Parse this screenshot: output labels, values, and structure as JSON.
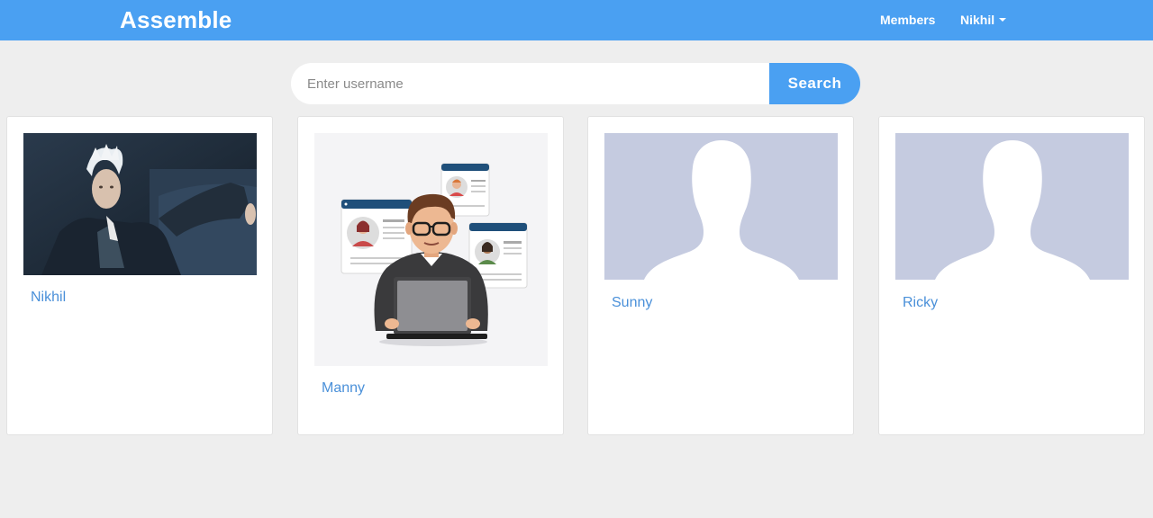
{
  "navbar": {
    "brand": "Assemble",
    "members_label": "Members",
    "user_label": "Nikhil",
    "color": "#4aa0f2"
  },
  "search": {
    "placeholder": "Enter username",
    "button_label": "Search"
  },
  "members": [
    {
      "name": "Nikhil",
      "avatar": "photo-avatar"
    },
    {
      "name": "Manny",
      "avatar": "developer-illustration"
    },
    {
      "name": "Sunny",
      "avatar": "default-silhouette"
    },
    {
      "name": "Ricky",
      "avatar": "default-silhouette"
    }
  ],
  "colors": {
    "background": "#eeeeee",
    "link": "#4a90d9",
    "silhouette_bg": "#c5cbe0"
  }
}
